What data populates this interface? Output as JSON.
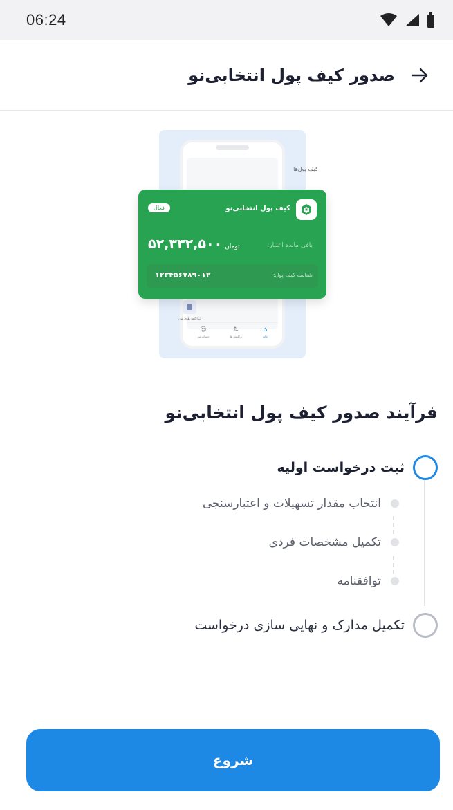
{
  "status_bar": {
    "time": "06:24"
  },
  "header": {
    "title": "صدور کیف پول انتخابی‌نو"
  },
  "illustration": {
    "phone_title": "کیف پول‌ها",
    "phone_item_label": "تراکنش‌های من",
    "nav_items": [
      {
        "label": "خانه",
        "icon": "home-icon"
      },
      {
        "label": "تراکنش ها",
        "icon": "transfer-icon"
      },
      {
        "label": "حساب من",
        "icon": "user-icon"
      }
    ],
    "card": {
      "name": "کیف پول انتخابی‌نو",
      "status": "فعال",
      "balance_label": "باقی مانده اعتبار:",
      "balance": "۵۲,۳۳۲,۵۰۰",
      "currency": "تومان",
      "id_label": "شناسه کیف پول:",
      "id": "۱۲۳۴۵۶۷۸۹۰۱۲",
      "color": "#27a352"
    }
  },
  "process": {
    "title": "فرآیند صدور کیف پول انتخابی‌نو",
    "steps": [
      {
        "label": "ثبت درخواست اولیه",
        "active": true
      },
      {
        "label": "تکمیل مدارک و نهایی سازی درخواست",
        "active": false
      }
    ],
    "substeps": [
      {
        "label": "انتخاب مقدار تسهیلات و اعتبارسنجی"
      },
      {
        "label": "تکمیل مشخصات فردی"
      },
      {
        "label": "توافقنامه"
      }
    ]
  },
  "actions": {
    "start_label": "شروع"
  },
  "colors": {
    "accent": "#1e88e5",
    "card_green": "#27a352"
  }
}
